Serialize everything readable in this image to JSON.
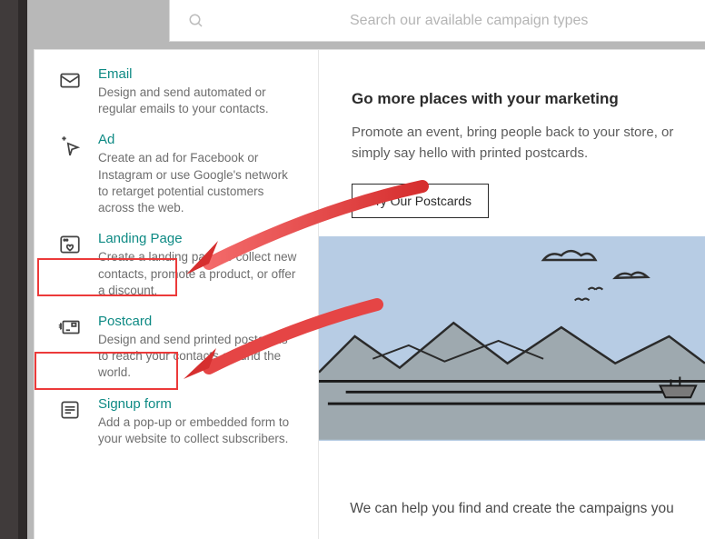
{
  "search": {
    "placeholder": "Search our available campaign types"
  },
  "items": {
    "email": {
      "title": "Email",
      "desc": "Design and send automated or regular emails to your contacts."
    },
    "ad": {
      "title": "Ad",
      "desc": "Create an ad for Facebook or Instagram or use Google's network to retarget potential customers across the web."
    },
    "landing": {
      "title": "Landing Page",
      "desc": "Create a landing page to collect new contacts, promote a product, or offer a discount."
    },
    "postcard": {
      "title": "Postcard",
      "desc": "Design and send printed postcards to reach your contacts around the world."
    },
    "signup": {
      "title": "Signup form",
      "desc": "Add a pop-up or embedded form to your website to collect subscribers."
    }
  },
  "promo": {
    "title": "Go more places with your marketing",
    "desc": "Promote an event, bring people back to your store, or simply say hello with printed postcards.",
    "cta": "Try Our Postcards"
  },
  "bottom_text": "We can help you find and create the campaigns you"
}
